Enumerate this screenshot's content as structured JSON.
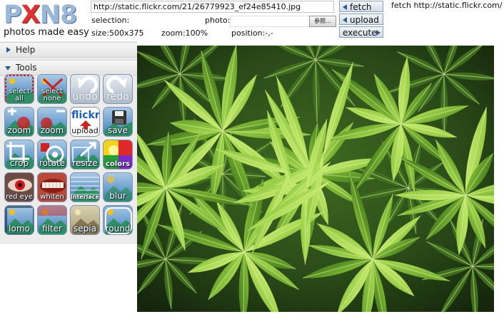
{
  "app": {
    "logo_text_a": "P",
    "logo_text_x": "X",
    "logo_text_b": "N8",
    "tagline": "photos made easy"
  },
  "toolbar": {
    "url_value": "http://static.flickr.com/21/26779923_ef24e85410.jpg",
    "selection_label": "selection:",
    "photo_label": "photo:",
    "browse_label": "参照...",
    "size_text": "size:500x375",
    "zoom_text": "zoom:100%",
    "position_text": "position:-,-",
    "fetch_label": "fetch",
    "upload_label": "upload",
    "execute_label": "execute",
    "status_text": "fetch http://static.flickr.com/"
  },
  "panel": {
    "help_label": "Help",
    "tools_label": "Tools"
  },
  "tools": [
    {
      "label": "select all",
      "line1": "select",
      "line2": "all"
    },
    {
      "label": "select none",
      "line1": "select",
      "line2": "none"
    },
    {
      "label": "undo"
    },
    {
      "label": "redo"
    },
    {
      "label": "zoom"
    },
    {
      "label": "zoom"
    },
    {
      "label": "upload",
      "brand": "flickr"
    },
    {
      "label": "save"
    },
    {
      "label": "crop"
    },
    {
      "label": "rotate"
    },
    {
      "label": "resize"
    },
    {
      "label": "colors"
    },
    {
      "label": "red eye"
    },
    {
      "label": "whiten"
    },
    {
      "label": "interlace"
    },
    {
      "label": "blur"
    },
    {
      "label": "lomo"
    },
    {
      "label": "filter"
    },
    {
      "label": "sepia"
    },
    {
      "label": "round"
    }
  ],
  "colors": {
    "accent": "#2b5a90",
    "tool_blue": "#6d9fcf",
    "photo_dark": "#243818",
    "leaf_green": "#7cb83a"
  }
}
